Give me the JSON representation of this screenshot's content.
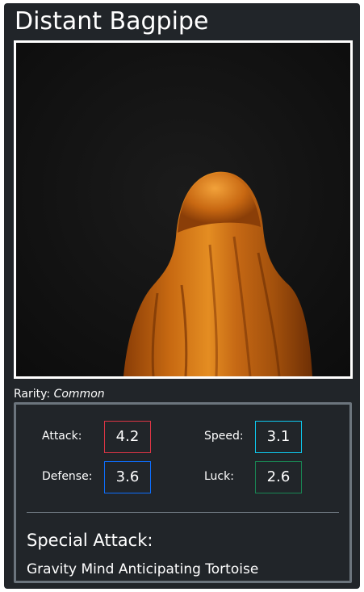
{
  "card": {
    "title": "Distant Bagpipe",
    "art_icon": "ghost-sheet-figure-image",
    "rarity_label": "Rarity:",
    "rarity_value": "Common",
    "stats": {
      "attack": {
        "label": "Attack:",
        "value": "4.2",
        "color": "#dc3545"
      },
      "speed": {
        "label": "Speed:",
        "value": "3.1",
        "color": "#0dcaf0"
      },
      "defense": {
        "label": "Defense:",
        "value": "3.6",
        "color": "#0d6efd"
      },
      "luck": {
        "label": "Luck:",
        "value": "2.6",
        "color": "#198754"
      }
    },
    "special_attack_heading": "Special Attack:",
    "special_attack_name": "Gravity Mind Anticipating Tortoise"
  },
  "colors": {
    "card_background": "#212529",
    "panel_border": "#6c757d",
    "frame_border": "#ffffff"
  }
}
